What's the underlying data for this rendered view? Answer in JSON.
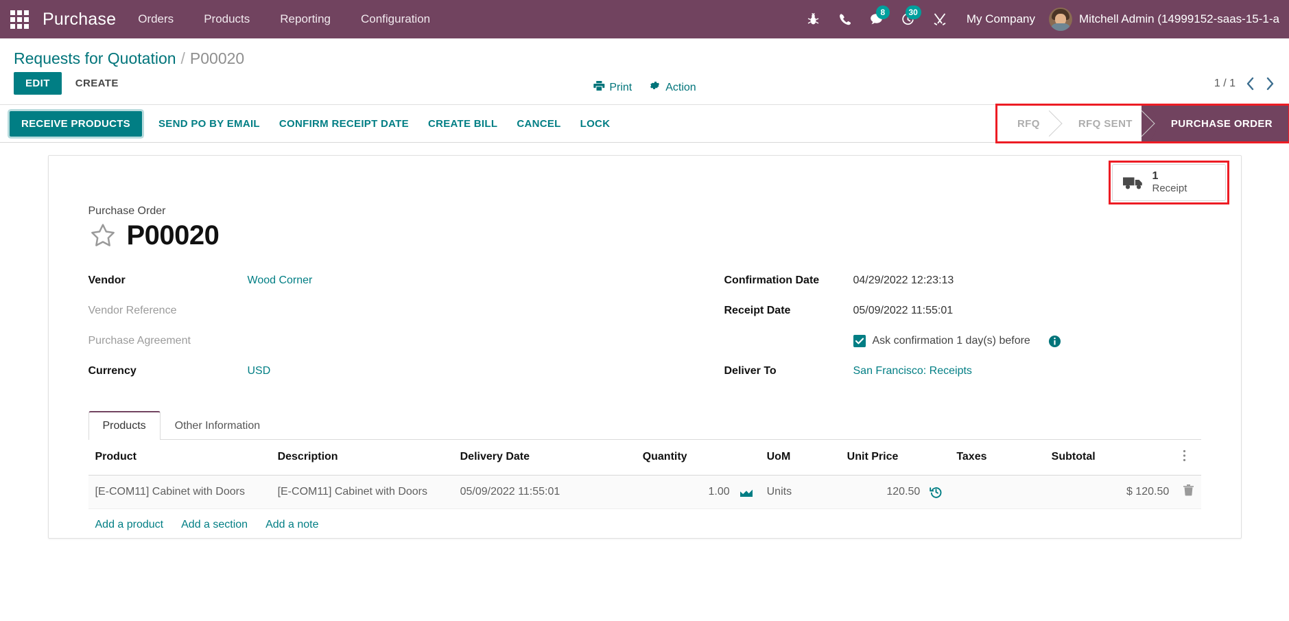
{
  "navbar": {
    "apps_icon": "apps-grid-icon",
    "brand": "Purchase",
    "menu": [
      {
        "label": "Orders"
      },
      {
        "label": "Products"
      },
      {
        "label": "Reporting"
      },
      {
        "label": "Configuration"
      }
    ],
    "icons": [
      {
        "name": "bug-icon",
        "badge": ""
      },
      {
        "name": "phone-icon",
        "badge": ""
      },
      {
        "name": "messages-icon",
        "badge": "8"
      },
      {
        "name": "activities-clock-icon",
        "badge": "30"
      },
      {
        "name": "tools-icon",
        "badge": ""
      }
    ],
    "company": "My Company",
    "username": "Mitchell Admin (14999152-saas-15-1-a",
    "bg_color": "#71435F",
    "badge_color": "#00A09D"
  },
  "control_panel": {
    "breadcrumb_root": "Requests for Quotation",
    "breadcrumb_separator": "/",
    "breadcrumb_current": "P00020",
    "edit_label": "EDIT",
    "create_label": "CREATE",
    "print_label": "Print",
    "action_label": "Action",
    "pager": "1 / 1"
  },
  "statusbar": {
    "buttons": [
      {
        "label": "RECEIVE PRODUCTS",
        "primary": true
      },
      {
        "label": "SEND PO BY EMAIL",
        "primary": false
      },
      {
        "label": "CONFIRM RECEIPT DATE",
        "primary": false
      },
      {
        "label": "CREATE BILL",
        "primary": false
      },
      {
        "label": "CANCEL",
        "primary": false
      },
      {
        "label": "LOCK",
        "primary": false
      }
    ],
    "stages": [
      {
        "label": "RFQ",
        "active": false
      },
      {
        "label": "RFQ SENT",
        "active": false
      },
      {
        "label": "PURCHASE ORDER",
        "active": true
      }
    ],
    "annotation_color": "#ED1C24"
  },
  "smart_button": {
    "icon": "truck-icon",
    "count": "1",
    "label": "Receipt"
  },
  "form": {
    "title_label": "Purchase Order",
    "star_icon": "star-outline-icon",
    "title": "P00020",
    "left_fields": [
      {
        "label": "Vendor",
        "value": "Wood Corner",
        "muted": false,
        "link": true
      },
      {
        "label": "Vendor Reference",
        "value": "",
        "muted": true,
        "link": false
      },
      {
        "label": "Purchase Agreement",
        "value": "",
        "muted": true,
        "link": false
      },
      {
        "label": "Currency",
        "value": "USD",
        "muted": false,
        "link": true
      }
    ],
    "right_fields": [
      {
        "label": "Confirmation Date",
        "value": "04/29/2022 12:23:13"
      },
      {
        "label": "Receipt Date",
        "value": "05/09/2022 11:55:01"
      }
    ],
    "ask_confirmation": {
      "checked": true,
      "text": "Ask confirmation 1  day(s) before",
      "info_icon": "info-circle-icon"
    },
    "deliver_to": {
      "label": "Deliver To",
      "value": "San Francisco: Receipts"
    }
  },
  "notebook": {
    "tabs": [
      {
        "label": "Products",
        "active": true
      },
      {
        "label": "Other Information",
        "active": false
      }
    ],
    "columns": [
      "Product",
      "Description",
      "Delivery Date",
      "Quantity",
      "UoM",
      "Unit Price",
      "Taxes",
      "Subtotal"
    ],
    "optional_columns_icon": "column-options-icon",
    "rows": [
      {
        "product": "[E-COM11] Cabinet with Doors",
        "description": "[E-COM11] Cabinet with Doors",
        "delivery_date": "05/09/2022 11:55:01",
        "quantity": "1.00",
        "quantity_icon": "forecast-chart-icon",
        "uom": "Units",
        "unit_price": "120.50",
        "unit_price_icon": "price-history-icon",
        "taxes": "",
        "subtotal": "$ 120.50",
        "delete_icon": "trash-icon"
      }
    ],
    "add_links": [
      {
        "label": "Add a product"
      },
      {
        "label": "Add a section"
      },
      {
        "label": "Add a note"
      }
    ]
  }
}
